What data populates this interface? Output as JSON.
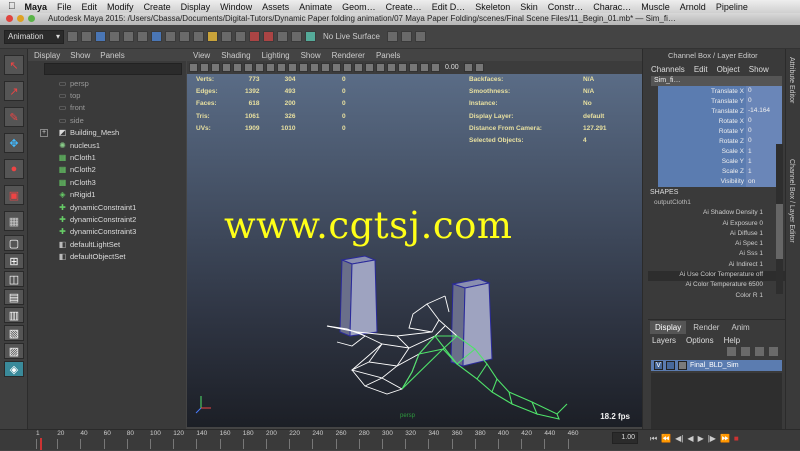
{
  "mac_menu": {
    "app": "Maya",
    "items": [
      "File",
      "Edit",
      "Modify",
      "Create",
      "Display",
      "Window",
      "Assets",
      "Animate",
      "Geom…",
      "Create…",
      "Edit D…",
      "Skeleton",
      "Skin",
      "Constr…",
      "Charac…",
      "Muscle",
      "Arnold",
      "Pipeline"
    ]
  },
  "title": "Autodesk Maya 2015: /Users/Cbassa/Documents/Digital-Tutors/Dynamic Paper folding animation/07 Maya Paper Folding/scenes/Final Scene Files/11_Begin_01.mb*  —  Sim_fi…",
  "status_line": {
    "mode": "Animation",
    "live_surface": "No Live Surface"
  },
  "outliner": {
    "menu": [
      "Display",
      "Show",
      "Panels"
    ],
    "items": [
      {
        "label": "persp",
        "icon": "camera-icon",
        "dim": true
      },
      {
        "label": "top",
        "icon": "camera-icon",
        "dim": true
      },
      {
        "label": "front",
        "icon": "camera-icon",
        "dim": true
      },
      {
        "label": "side",
        "icon": "camera-icon",
        "dim": true
      },
      {
        "label": "Building_Mesh",
        "icon": "mesh-icon",
        "dim": false
      },
      {
        "label": "nucleus1",
        "icon": "nucleus-icon",
        "dim": false
      },
      {
        "label": "nCloth1",
        "icon": "ncloth-icon",
        "dim": false
      },
      {
        "label": "nCloth2",
        "icon": "ncloth-icon",
        "dim": false
      },
      {
        "label": "nCloth3",
        "icon": "ncloth-icon",
        "dim": false
      },
      {
        "label": "nRigid1",
        "icon": "nrigid-icon",
        "dim": false
      },
      {
        "label": "dynamicConstraint1",
        "icon": "constraint-icon",
        "dim": false
      },
      {
        "label": "dynamicConstraint2",
        "icon": "constraint-icon",
        "dim": false
      },
      {
        "label": "dynamicConstraint3",
        "icon": "constraint-icon",
        "dim": false
      },
      {
        "label": "defaultLightSet",
        "icon": "set-icon",
        "dim": false
      },
      {
        "label": "defaultObjectSet",
        "icon": "set-icon",
        "dim": false
      }
    ]
  },
  "viewport": {
    "menu": [
      "View",
      "Shading",
      "Lighting",
      "Show",
      "Renderer",
      "Panels"
    ],
    "toolbar_value": "0.00",
    "hud_left": [
      {
        "label": "Verts:",
        "v1": "773",
        "v2": "304",
        "v3": "0"
      },
      {
        "label": "Edges:",
        "v1": "1392",
        "v2": "493",
        "v3": "0"
      },
      {
        "label": "Faces:",
        "v1": "618",
        "v2": "200",
        "v3": "0"
      },
      {
        "label": "Tris:",
        "v1": "1061",
        "v2": "326",
        "v3": "0"
      },
      {
        "label": "UVs:",
        "v1": "1909",
        "v2": "1010",
        "v3": "0"
      }
    ],
    "hud_right": [
      {
        "label": "Backfaces:",
        "value": "N/A"
      },
      {
        "label": "Smoothness:",
        "value": "N/A"
      },
      {
        "label": "Instance:",
        "value": "No"
      },
      {
        "label": "Display Layer:",
        "value": "default"
      },
      {
        "label": "Distance From Camera:",
        "value": "127.291"
      },
      {
        "label": "Selected Objects:",
        "value": "4"
      }
    ],
    "watermark": "www.cgtsj.com",
    "camera": "persp",
    "fps": "18.2 fps"
  },
  "channel_box": {
    "title": "Channel Box / Layer Editor",
    "menu": [
      "Channels",
      "Edit",
      "Object",
      "Show"
    ],
    "object": "Sim_fi…",
    "attributes": [
      {
        "name": "Translate X",
        "value": "0"
      },
      {
        "name": "Translate Y",
        "value": "0"
      },
      {
        "name": "Translate Z",
        "value": "-14.164"
      },
      {
        "name": "Rotate X",
        "value": "0"
      },
      {
        "name": "Rotate Y",
        "value": "0"
      },
      {
        "name": "Rotate Z",
        "value": "0"
      },
      {
        "name": "Scale X",
        "value": "1"
      },
      {
        "name": "Scale Y",
        "value": "1"
      },
      {
        "name": "Scale Z",
        "value": "1"
      },
      {
        "name": "Visibility",
        "value": "on"
      }
    ],
    "shapes_header": "SHAPES",
    "shape_node": "outputCloth1",
    "shape_attrs": [
      "Ai Shadow Density 1",
      "Ai Exposure 0",
      "Ai Diffuse 1",
      "Ai Spec 1",
      "Ai Sss 1",
      "Ai Indirect 1",
      "Ai Use Color Temperature off",
      "Ai Color Temperature 6500",
      "Color R 1"
    ]
  },
  "layer_editor": {
    "tabs": [
      "Display",
      "Render",
      "Anim"
    ],
    "menu": [
      "Layers",
      "Options",
      "Help"
    ],
    "layer": {
      "visible": "V",
      "name": "Final_BLD_Sim"
    }
  },
  "side_tabs": [
    "Attribute Editor",
    "Channel Box / Layer Editor"
  ],
  "timeline": {
    "ticks": [
      "1",
      "20",
      "40",
      "60",
      "80",
      "100",
      "120",
      "140",
      "160",
      "180",
      "200",
      "220",
      "240",
      "260",
      "280",
      "300",
      "320",
      "340",
      "360",
      "380",
      "400",
      "420",
      "440",
      "460"
    ],
    "current_frame": "1.00",
    "frame_fraction": 0.0
  },
  "colors": {
    "layer_blue": "#5b7cb0",
    "watermark": "#ffff18",
    "hud": "#e8e0a0"
  }
}
